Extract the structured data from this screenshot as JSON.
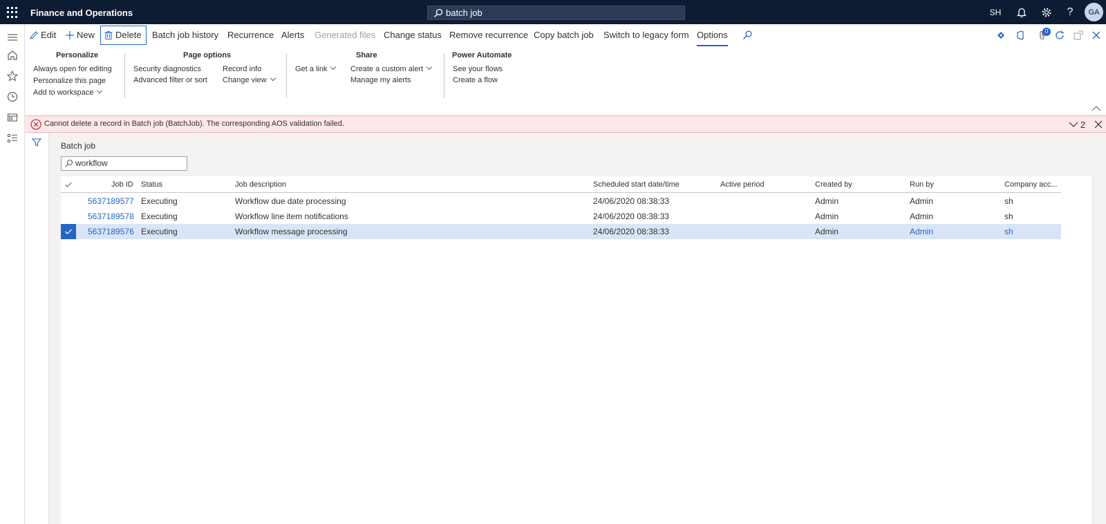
{
  "app": {
    "title": "Finance and Operations",
    "search_value": "batch job",
    "company": "SH",
    "user_initials": "GA"
  },
  "actions": {
    "edit": "Edit",
    "new": "New",
    "delete": "Delete",
    "batch_job_history": "Batch job history",
    "recurrence": "Recurrence",
    "alerts": "Alerts",
    "generated_files": "Generated files",
    "change_status": "Change status",
    "remove_recurrence": "Remove recurrence",
    "copy_batch_job": "Copy batch job",
    "switch_legacy": "Switch to legacy form",
    "options": "Options",
    "notification_count": "0"
  },
  "ribbon": {
    "personalize": {
      "title": "Personalize",
      "always_open": "Always open for editing",
      "personalize_page": "Personalize this page",
      "add_workspace": "Add to workspace"
    },
    "page_options": {
      "title": "Page options",
      "security_diagnostics": "Security diagnostics",
      "advanced_filter": "Advanced filter or sort",
      "record_info": "Record info",
      "change_view": "Change view"
    },
    "share": {
      "title": "Share",
      "get_link": "Get a link",
      "create_alert": "Create a custom alert",
      "manage_alerts": "Manage my alerts"
    },
    "power_automate": {
      "title": "Power Automate",
      "see_flows": "See your flows",
      "create_flow": "Create a flow"
    }
  },
  "error": {
    "message": "Cannot delete a record in Batch job (BatchJob). The corresponding AOS validation failed.",
    "count": "2"
  },
  "page": {
    "title": "Batch job",
    "filter_value": "workflow"
  },
  "grid": {
    "headers": {
      "job_id": "Job ID",
      "status": "Status",
      "description": "Job description",
      "scheduled": "Scheduled start date/time",
      "active_period": "Active period",
      "created_by": "Created by",
      "run_by": "Run by",
      "company": "Company acc..."
    },
    "rows": [
      {
        "job_id": "5637189577",
        "status": "Executing",
        "description": "Workflow due date processing",
        "scheduled": "24/06/2020 08:38:33",
        "active_period": "",
        "created_by": "Admin",
        "run_by": "Admin",
        "company": "sh"
      },
      {
        "job_id": "5637189578",
        "status": "Executing",
        "description": "Workflow line item notifications",
        "scheduled": "24/06/2020 08:38:33",
        "active_period": "",
        "created_by": "Admin",
        "run_by": "Admin",
        "company": "sh"
      },
      {
        "job_id": "5637189576",
        "status": "Executing",
        "description": "Workflow message processing",
        "scheduled": "24/06/2020 08:38:33",
        "active_period": "",
        "created_by": "Admin",
        "run_by": "Admin",
        "company": "sh"
      }
    ]
  },
  "colors": {
    "header_bg": "#0d1b33",
    "accent": "#2266c6",
    "error_bg": "#fde7e9",
    "selected_row": "#d9e5f7"
  }
}
